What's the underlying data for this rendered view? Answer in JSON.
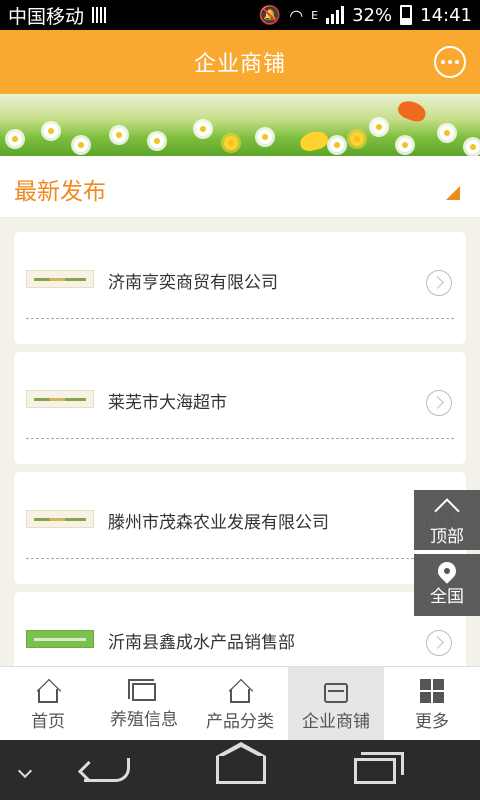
{
  "statusbar": {
    "carrier": "中国移动",
    "network_type": "E",
    "battery": "32%",
    "time": "14:41"
  },
  "header": {
    "title": "企业商铺",
    "action_icon": "chat-bubble-icon"
  },
  "section": {
    "title": "最新发布",
    "indicator_icon": "corner-triangle-icon"
  },
  "companies": [
    {
      "name": "济南亨奕商贸有限公司"
    },
    {
      "name": "莱芜市大海超市"
    },
    {
      "name": "滕州市茂森农业发展有限公司"
    },
    {
      "name": "沂南县鑫成水产品销售部"
    }
  ],
  "floating": {
    "top_label": "顶部",
    "nation_label": "全国"
  },
  "tabbar": {
    "items": [
      {
        "label": "首页",
        "icon": "home-icon"
      },
      {
        "label": "养殖信息",
        "icon": "breeding-info-icon"
      },
      {
        "label": "产品分类",
        "icon": "category-icon"
      },
      {
        "label": "企业商铺",
        "icon": "shop-icon",
        "active": true
      },
      {
        "label": "更多",
        "icon": "grid-icon"
      }
    ]
  },
  "colors": {
    "brand_orange": "#f9a92f",
    "section_orange": "#f08a1e"
  }
}
